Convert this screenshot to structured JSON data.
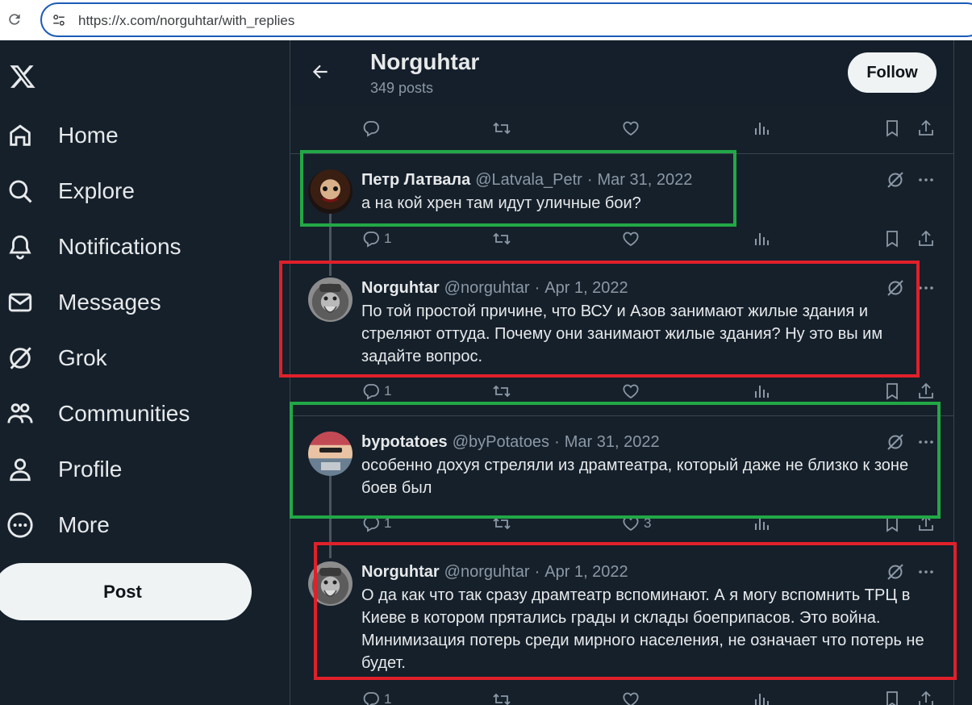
{
  "browser": {
    "url": "https://x.com/norguhtar/with_replies",
    "icons": [
      "reload-icon",
      "tune-icon"
    ]
  },
  "sidebar": {
    "logo": "x-logo",
    "items": [
      {
        "label": "Home",
        "icon": "home-icon"
      },
      {
        "label": "Explore",
        "icon": "search-icon"
      },
      {
        "label": "Notifications",
        "icon": "bell-icon"
      },
      {
        "label": "Messages",
        "icon": "mail-icon"
      },
      {
        "label": "Grok",
        "icon": "grok-icon"
      },
      {
        "label": "Communities",
        "icon": "communities-icon"
      },
      {
        "label": "Profile",
        "icon": "person-icon"
      },
      {
        "label": "More",
        "icon": "more-circle-icon"
      }
    ],
    "post_label": "Post"
  },
  "header": {
    "title": "Norguhtar",
    "posts": "349 posts",
    "follow_label": "Follow"
  },
  "tweets": [
    {
      "name": "Петр Латвала",
      "handle": "@Latvala_Petr",
      "date": "Mar 31, 2022",
      "text": "а на кой хрен там идут уличные бои?",
      "replies": "1",
      "likes": ""
    },
    {
      "name": "Norguhtar",
      "handle": "@norguhtar",
      "date": "Apr 1, 2022",
      "text": "По той простой причине, что ВСУ и Азов занимают жилые здания и стреляют оттуда. Почему они занимают жилые здания? Ну это вы им задайте вопрос.",
      "replies": "1",
      "likes": ""
    },
    {
      "name": "bypotatoes",
      "handle": "@byPotatoes",
      "date": "Mar 31, 2022",
      "text": "особенно дохуя стреляли из драмтеатра, который даже не близко к зоне боев был",
      "replies": "1",
      "likes": "3"
    },
    {
      "name": "Norguhtar",
      "handle": "@norguhtar",
      "date": "Apr 1, 2022",
      "text": "О да как что так сразу драмтеатр вспоминают. А я могу вспомнить ТРЦ в Киеве в котором прятались грады и склады боеприпасов. Это война. Минимизация потерь среди мирного населения, не означает что потерь не будет.",
      "replies": "1",
      "likes": ""
    }
  ],
  "highlight_colors": {
    "green": "#22a846",
    "red": "#e0202a"
  },
  "theme": {
    "background": "#15202b",
    "muted": "#8b98a5",
    "text": "#e7e9ea"
  }
}
